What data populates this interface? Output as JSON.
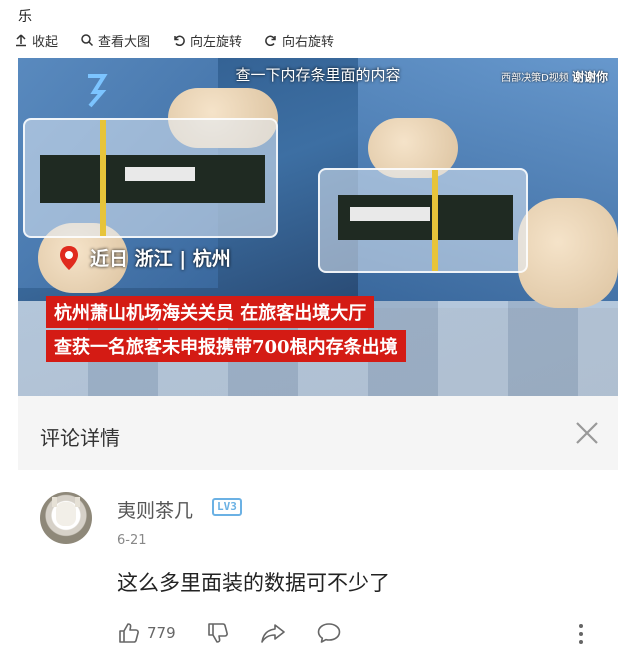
{
  "top_title": "乐",
  "toolbar": {
    "collapse": "收起",
    "view_large": "查看大图",
    "rotate_left": "向左旋转",
    "rotate_right": "向右旋转"
  },
  "video": {
    "caption": "查一下内存条里面的内容",
    "watermark_right": "西部决策D视频",
    "watermark_right_tag": "谢谢你",
    "location": "近日 浙江 | 杭州",
    "headline_1": "杭州萧山机场海关关员 在旅客出境大厅",
    "headline_2": "查获一名旅客未申报携带700根内存条出境"
  },
  "comment_panel": {
    "title": "评论详情"
  },
  "comment": {
    "username": "夷则茶几",
    "level": "LV3",
    "date": "6-21",
    "text": "这么多里面装的数据可不少了",
    "likes": "779"
  },
  "colors": {
    "accent_red": "#d41b14",
    "level_blue": "#6bb1e4"
  }
}
